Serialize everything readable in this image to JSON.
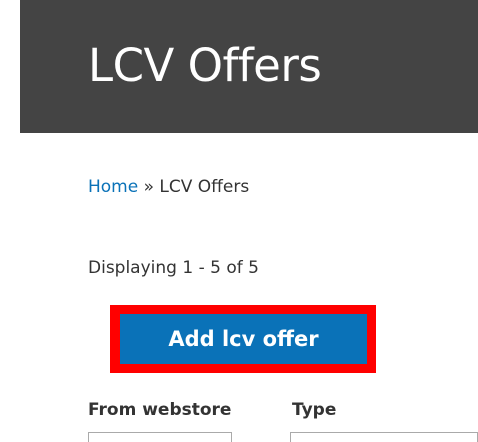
{
  "header": {
    "title": "LCV Offers"
  },
  "breadcrumb": {
    "home_label": "Home",
    "separator": " » ",
    "current": "LCV Offers"
  },
  "summary": {
    "text": "Displaying 1 - 5 of 5"
  },
  "actions": {
    "add_label": "Add lcv offer"
  },
  "filters": {
    "webstore_label": "From webstore",
    "type_label": "Type"
  },
  "colors": {
    "header_bg": "#444444",
    "link": "#0a72b8",
    "button_bg": "#0a72b8",
    "highlight": "#ff0000"
  }
}
